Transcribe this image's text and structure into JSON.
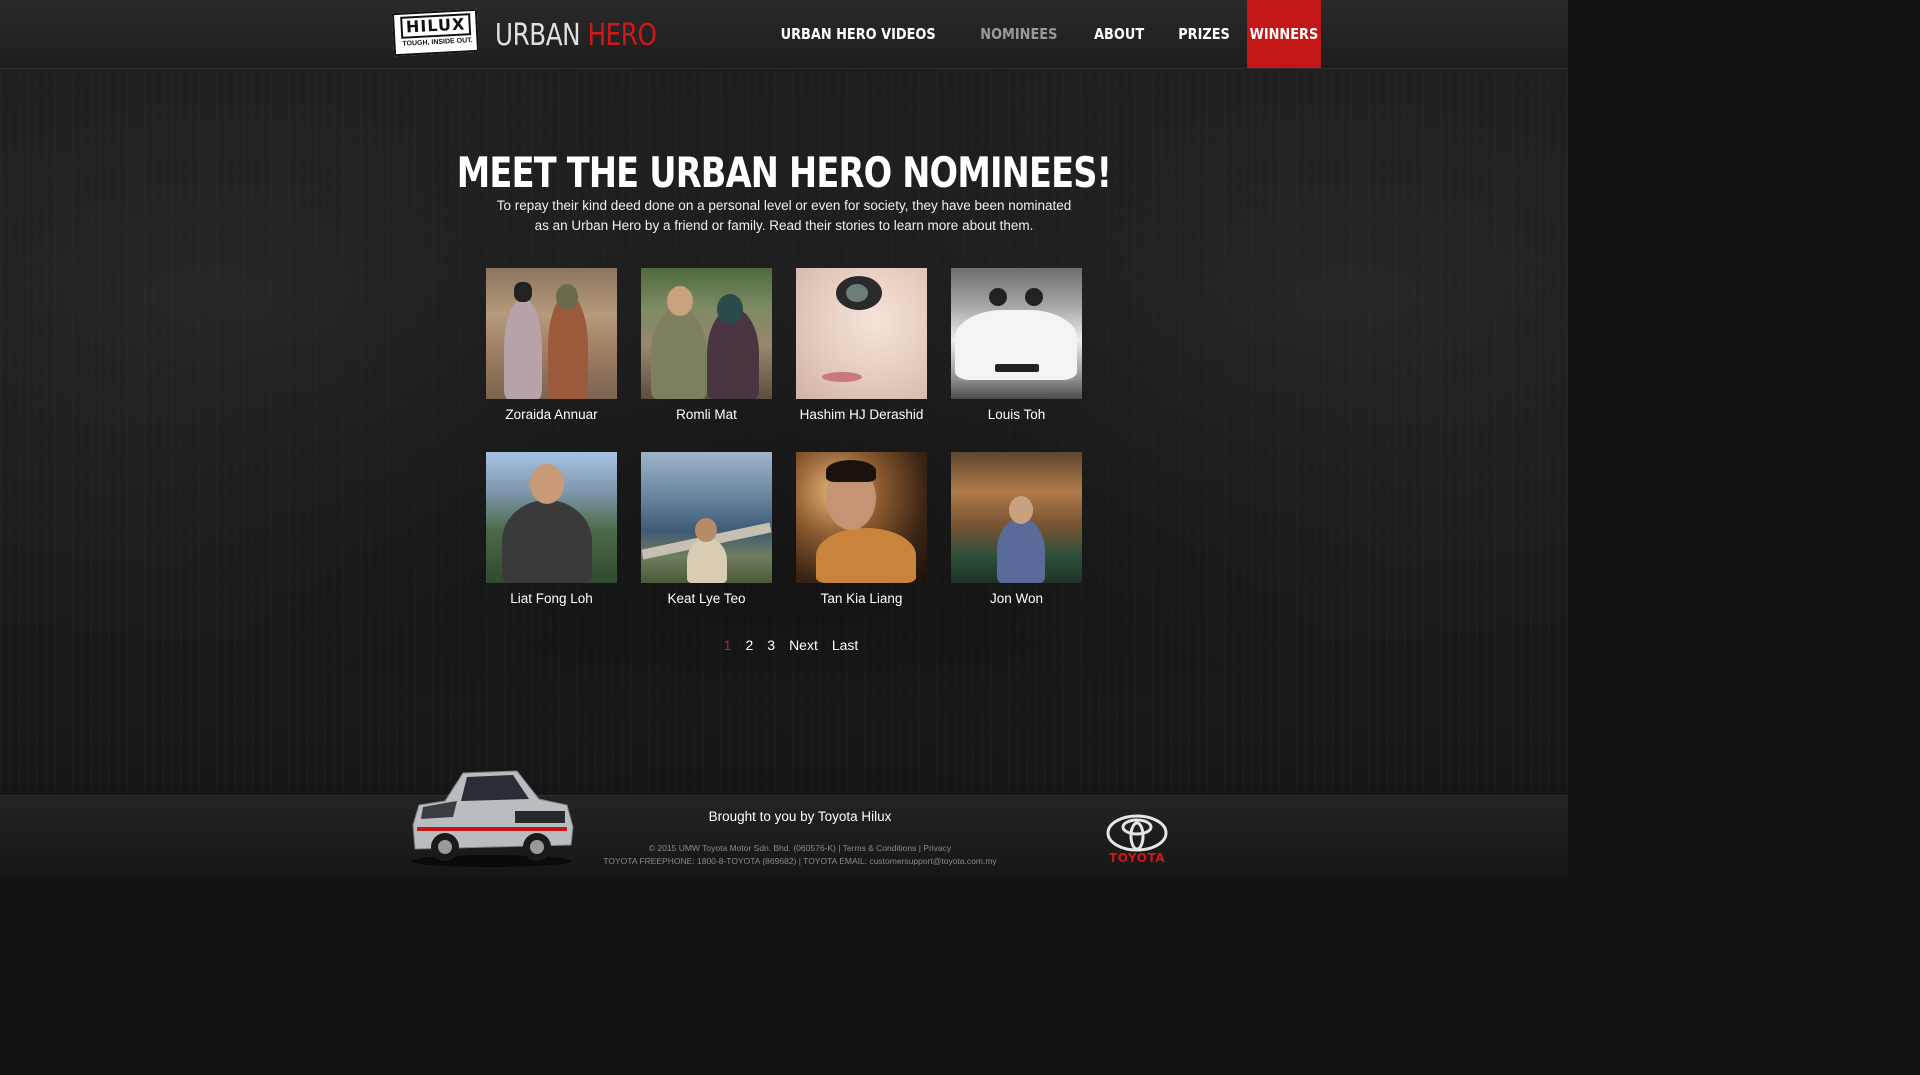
{
  "header": {
    "logo": {
      "word": "HILUX",
      "tagline": "TOUGH, INSIDE OUT."
    },
    "brand": {
      "part1": "URBAN",
      "part2": "HERO"
    },
    "nav": [
      {
        "label": "URBAN HERO VIDEOS",
        "state": "normal"
      },
      {
        "label": "NOMINEES",
        "state": "muted"
      },
      {
        "label": "ABOUT",
        "state": "normal"
      },
      {
        "label": "PRIZES",
        "state": "normal"
      },
      {
        "label": "WINNERS",
        "state": "active"
      }
    ]
  },
  "main": {
    "title": "MEET THE URBAN HERO NOMINEES!",
    "subtitle": "To repay their kind deed done on a personal level or even for society, they have been nominated as an Urban Hero by a friend or family. Read their stories to learn more about them.",
    "nominees": [
      {
        "name": "Zoraida Annuar"
      },
      {
        "name": "Romli Mat"
      },
      {
        "name": "Hashim HJ Derashid"
      },
      {
        "name": "Louis Toh"
      },
      {
        "name": "Liat Fong Loh"
      },
      {
        "name": "Keat Lye Teo"
      },
      {
        "name": "Tan Kia Liang"
      },
      {
        "name": "Jon Won"
      }
    ],
    "pagination": {
      "pages": [
        "1",
        "2",
        "3"
      ],
      "current": "1",
      "next": "Next",
      "last": "Last"
    }
  },
  "footer": {
    "brought": "Brought to you by Toyota Hilux",
    "copyright": "© 2015 UMW Toyota Motor Sdn. Bhd. (060576-K)",
    "terms": "Terms & Conditions",
    "privacy": "Privacy",
    "contact": "TOYOTA FREEPHONE: 1800-8-TOYOTA (869682) | TOYOTA EMAIL: customersupport@toyota.com.my",
    "toyota_word": "TOYOTA"
  },
  "colors": {
    "accent": "#c31616",
    "background": "#141414",
    "text": "#ffffff"
  }
}
